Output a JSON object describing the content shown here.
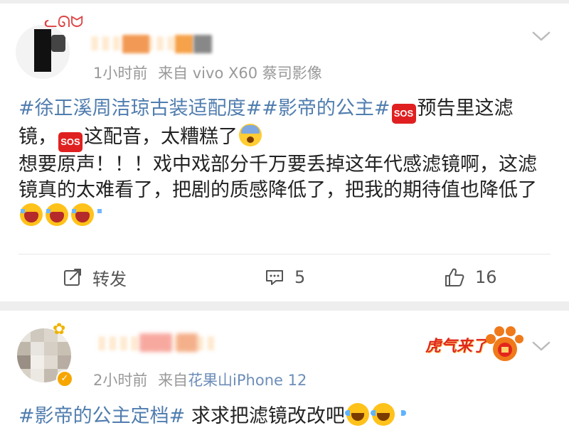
{
  "posts": [
    {
      "meta": {
        "time": "1小时前",
        "from": "来自",
        "source": "vivo X60 蔡司影像"
      },
      "content": {
        "hashtag": "#徐正溪周洁琼古装适配度##影帝的公主#",
        "sos_label": "SOS",
        "text1": "预告里这滤镜，",
        "text2": "这配音，太糟糕了",
        "text3": "想要原声！！！戏中戏部分千万要丢掉这年代感滤镜啊，这滤镜真的太难看了，把剧的质感降低了，把我的期待值也降低了"
      },
      "actions": {
        "repost_label": "转发",
        "comment_count": "5",
        "like_count": "16"
      },
      "icons": {
        "repost": "repost-icon",
        "comment": "comment-icon",
        "like": "thumbs-up-icon",
        "more": "chevron-down-icon"
      }
    },
    {
      "meta": {
        "time": "2小时前",
        "from": "来自",
        "source": "花果山iPhone 12"
      },
      "content": {
        "hashtag": "#影帝的公主定档#",
        "text1": "求求把滤镜改改吧"
      },
      "decoration": {
        "badge_text": "虎气来了"
      }
    }
  ],
  "colors": {
    "link": "#507daf",
    "meta": "#999999",
    "sos": "#e02020",
    "verified": "#f7a600"
  }
}
